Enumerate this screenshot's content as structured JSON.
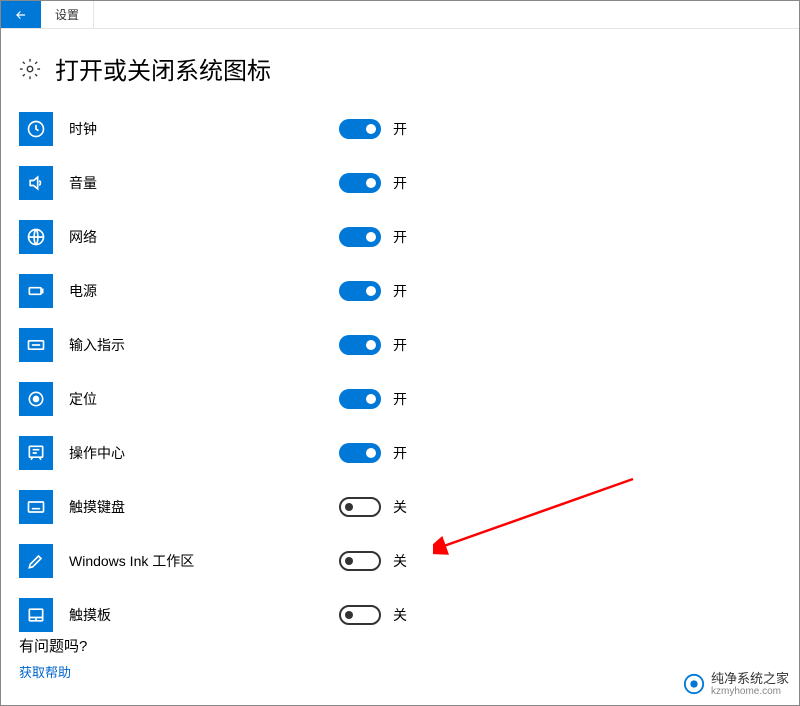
{
  "titlebar": {
    "tab": "设置"
  },
  "page": {
    "title": "打开或关闭系统图标"
  },
  "labels": {
    "on": "开",
    "off": "关"
  },
  "items": [
    {
      "label": "时钟",
      "on": true
    },
    {
      "label": "音量",
      "on": true
    },
    {
      "label": "网络",
      "on": true
    },
    {
      "label": "电源",
      "on": true
    },
    {
      "label": "输入指示",
      "on": true
    },
    {
      "label": "定位",
      "on": true
    },
    {
      "label": "操作中心",
      "on": true
    },
    {
      "label": "触摸键盘",
      "on": false
    },
    {
      "label": "Windows Ink 工作区",
      "on": false
    },
    {
      "label": "触摸板",
      "on": false
    }
  ],
  "help": {
    "question": "有问题吗?",
    "link": "获取帮助"
  },
  "watermark": {
    "title": "纯净系统之家",
    "url": "kzmyhome.com"
  }
}
